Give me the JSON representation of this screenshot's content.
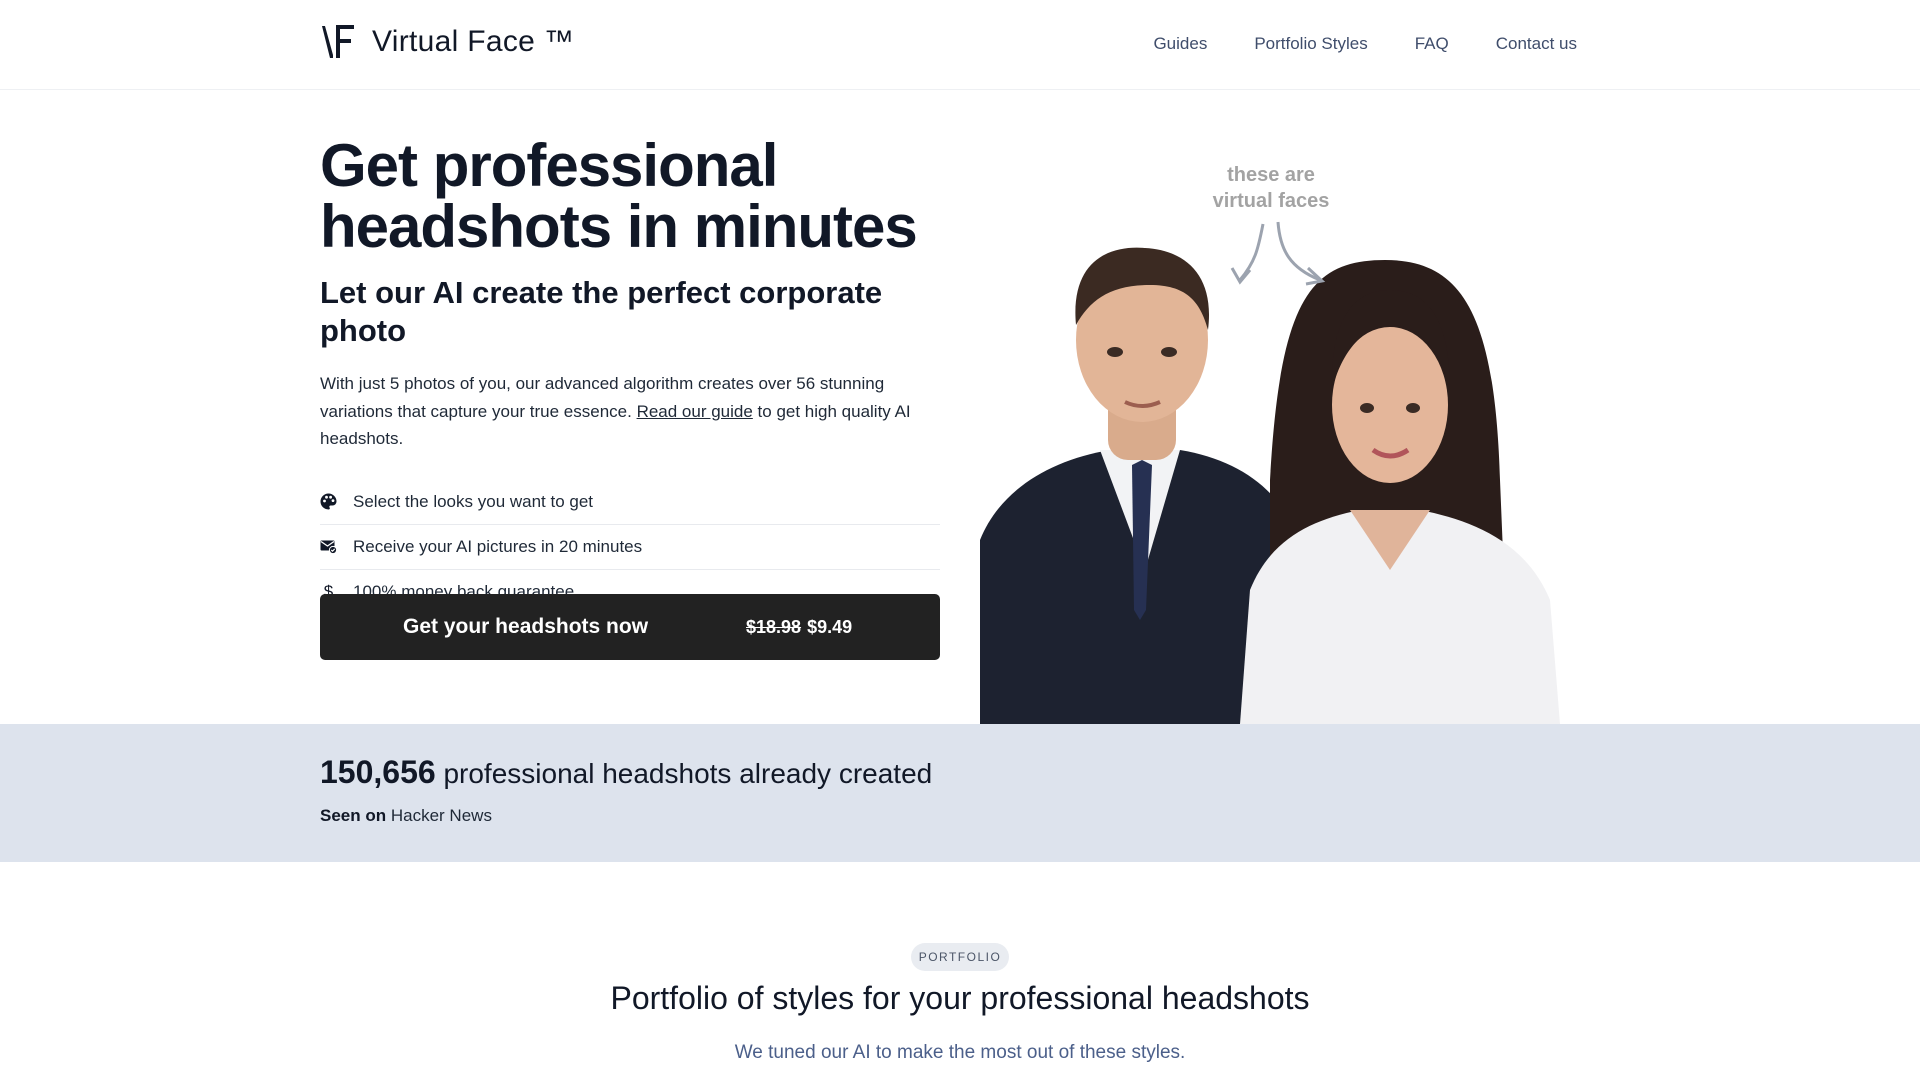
{
  "header": {
    "brand": "Virtual Face ™",
    "nav": [
      "Guides",
      "Portfolio Styles",
      "FAQ",
      "Contact us"
    ]
  },
  "hero": {
    "title": "Get professional headshots in minutes",
    "subtitle": "Let our AI create the perfect corporate photo",
    "description_before": "With just 5 photos of you, our advanced algorithm creates over 56 stunning variations that capture your true essence. ",
    "guide_link": "Read our guide",
    "description_after": " to get high quality AI headshots.",
    "features": [
      {
        "icon": "palette-icon",
        "text": "Select the looks you want to get"
      },
      {
        "icon": "mail-check-icon",
        "text": "Receive your AI pictures in 20 minutes"
      },
      {
        "icon": "dollar-icon",
        "text": "100% money back guarantee"
      }
    ],
    "cta": {
      "label": "Get your headshots now",
      "old_price": "$18.98",
      "new_price": "$9.49"
    },
    "annotation": "these are virtual faces"
  },
  "stats": {
    "count": "150,656",
    "text": " professional headshots already created",
    "seen_label": "Seen on",
    "seen_source": "Hacker News"
  },
  "portfolio": {
    "badge": "PORTFOLIO",
    "title": "Portfolio of styles for your professional headshots",
    "subtitle": "We tuned our AI to make the most out of these styles."
  },
  "colors": {
    "cta_bg": "#222222",
    "stats_bg": "#dde3ed",
    "nav_text": "#3f4d6b"
  }
}
